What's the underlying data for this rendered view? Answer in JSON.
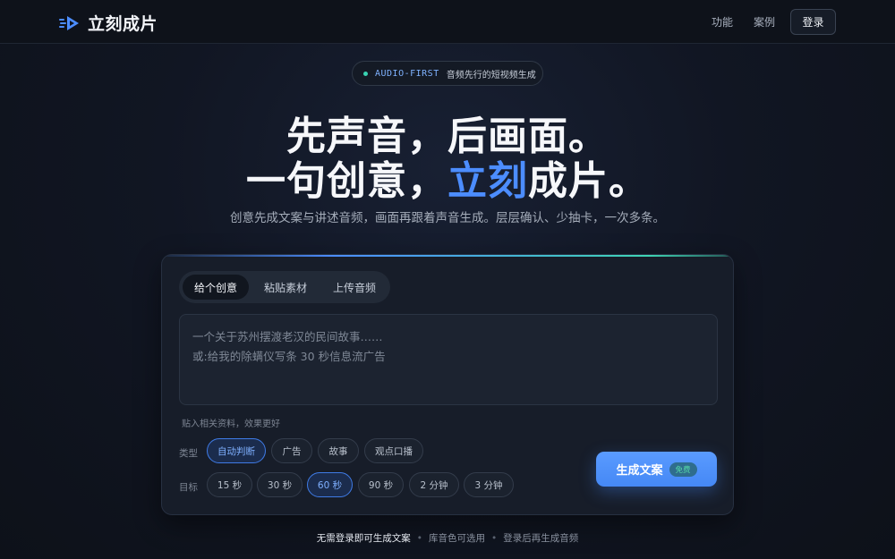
{
  "header": {
    "brand": "立刻成片",
    "nav": [
      "功能",
      "案例"
    ],
    "login_label": "登录"
  },
  "badge": {
    "code": "AUDIO-FIRST",
    "text": "音频先行的短视频生成"
  },
  "hero": {
    "line1": "先声音，后画面。",
    "line2_before": "一句创意，",
    "line2_accent": "立刻",
    "line2_after": "成片。",
    "subtitle": "创意先成文案与讲述音频，画面再跟着声音生成。层层确认、少抽卡，一次多条。"
  },
  "card": {
    "tabs": [
      {
        "label": "给个创意",
        "active": true
      },
      {
        "label": "粘贴素材",
        "active": false
      },
      {
        "label": "上传音频",
        "active": false
      }
    ],
    "textarea_placeholder": "一个关于苏州摆渡老汉的民间故事……\n或:给我的除螨仪写条 30 秒信息流广告",
    "hint": "贴入相关资料，效果更好",
    "type_label": "类型",
    "type_options": [
      {
        "label": "自动判断",
        "selected": true
      },
      {
        "label": "广告",
        "selected": false
      },
      {
        "label": "故事",
        "selected": false
      },
      {
        "label": "观点口播",
        "selected": false
      }
    ],
    "target_label": "目标",
    "target_options": [
      {
        "label": "15 秒",
        "selected": false
      },
      {
        "label": "30 秒",
        "selected": false
      },
      {
        "label": "60 秒",
        "selected": true
      },
      {
        "label": "90 秒",
        "selected": false
      },
      {
        "label": "2 分钟",
        "selected": false
      },
      {
        "label": "3 分钟",
        "selected": false
      }
    ],
    "generate_label": "生成文案",
    "generate_badge": "免费"
  },
  "footer": {
    "items": [
      "无需登录即可生成文案",
      "库音色可选用",
      "登录后再生成音频"
    ]
  },
  "colors": {
    "accent": "#4c8dff",
    "teal": "#3fd4b4",
    "background": "#0f131c"
  }
}
